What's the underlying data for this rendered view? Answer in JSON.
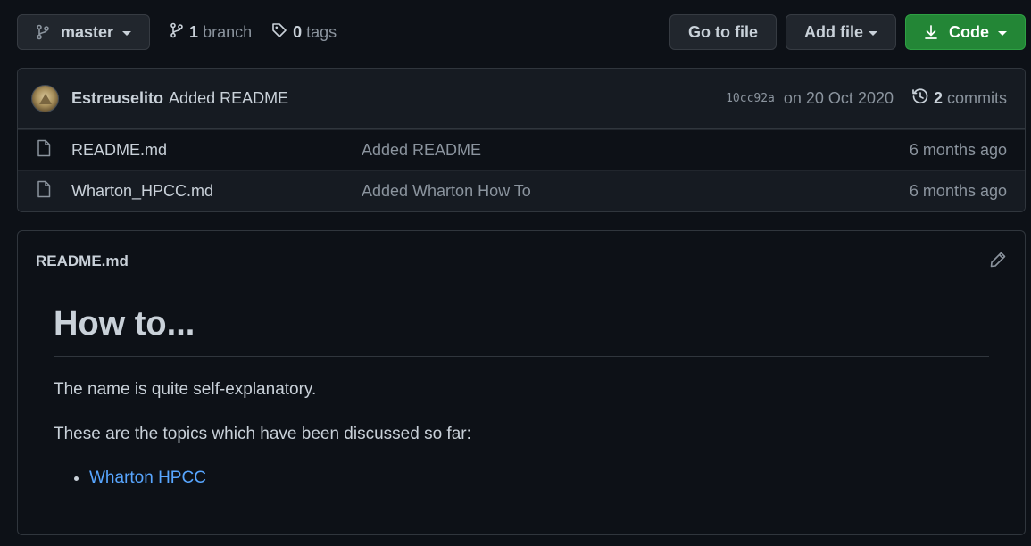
{
  "toolbar": {
    "branch_name": "master",
    "branch_count": "1",
    "branch_label": "branch",
    "tag_count": "0",
    "tag_label": "tags",
    "go_to_file": "Go to file",
    "add_file": "Add file",
    "code": "Code"
  },
  "latest_commit": {
    "author": "Estreuselito",
    "message": "Added README",
    "sha": "10cc92a",
    "date": "on 20 Oct 2020",
    "commit_count": "2",
    "commit_label": "commits"
  },
  "files": [
    {
      "name": "README.md",
      "message": "Added README",
      "age": "6 months ago"
    },
    {
      "name": "Wharton_HPCC.md",
      "message": "Added Wharton How To",
      "age": "6 months ago"
    }
  ],
  "readme": {
    "filename": "README.md",
    "heading": "How to...",
    "paragraph1": "The name is quite self-explanatory.",
    "paragraph2": "These are the topics which have been discussed so far:",
    "links": [
      "Wharton HPCC"
    ]
  },
  "colors": {
    "background": "#0d1117",
    "accent_green": "#238636",
    "link_blue": "#58a6ff"
  },
  "icons": {
    "branch": "git-branch-icon",
    "tag": "tag-icon",
    "download": "download-icon",
    "history": "history-icon",
    "file": "file-icon",
    "edit": "pencil-icon"
  }
}
